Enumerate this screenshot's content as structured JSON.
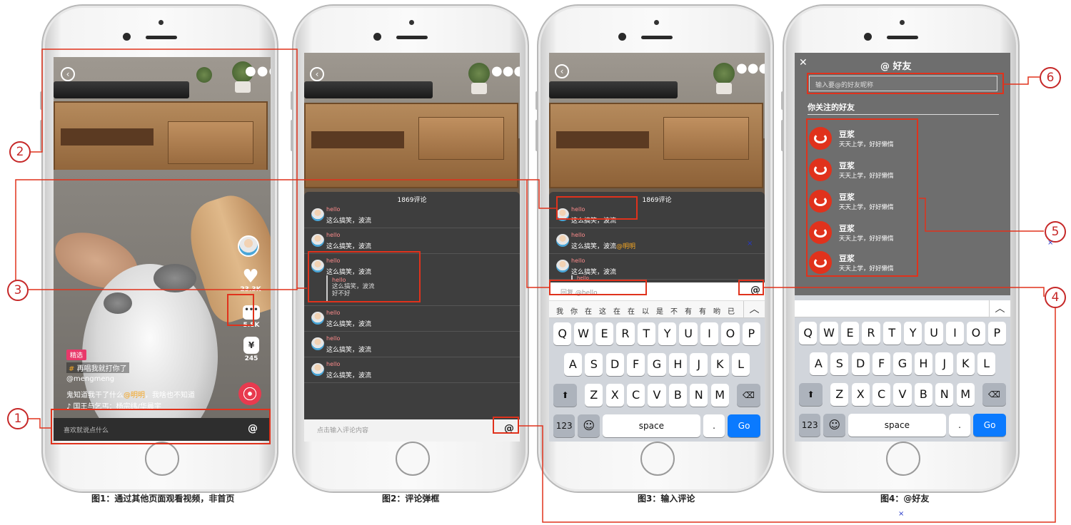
{
  "phone1": {
    "tag": "精选",
    "hashtag_symbol": "#",
    "hashtag": "再唱我就打你了",
    "username": "@mengmeng",
    "caption_pre": "鬼知道我干了什么",
    "caption_mention": "@明明",
    "caption_post": "，我啥也不知道",
    "music": "♪ 国王与乞丐：杨宗纬/华晨宇",
    "likes": "23.3K",
    "comments": "5.8K",
    "coins": "245",
    "coin_symbol": "¥",
    "input_placeholder": "喜欢就说点什么",
    "at_symbol": "@",
    "caption_label": "图1：通过其他页面观看视频，非首页"
  },
  "phone2": {
    "count": "1869评论",
    "comments": [
      {
        "name": "hello",
        "text": "这么搞笑，波流"
      },
      {
        "name": "hello",
        "text": "这么搞笑，波流"
      },
      {
        "name": "hello",
        "text": "这么搞笑，波流",
        "reply_name": "hello",
        "reply_text": "这么搞笑，波流",
        "reply_text2": "好不好"
      },
      {
        "name": "hello",
        "text": "这么搞笑，波流"
      },
      {
        "name": "hello",
        "text": "这么搞笑，波流"
      },
      {
        "name": "hello",
        "text": "这么搞笑，波流"
      }
    ],
    "input_placeholder": "点击输入评论内容",
    "at_symbol": "@",
    "caption_label": "图2：评论弹框"
  },
  "phone3": {
    "count": "1869评论",
    "c1_name": "hello",
    "c1_text": "这么搞笑，波流",
    "c2_name": "hello",
    "c2_text": "这么搞笑，波流",
    "c2_mention": "@明明",
    "c3_name": "hello",
    "c3_text": "这么搞笑，波流",
    "c4_name": "hello",
    "reply_placeholder": "回复 @hello",
    "at_symbol": "@",
    "candidates": [
      "我",
      "你",
      "在",
      "这",
      "在",
      "在",
      "以",
      "是",
      "不",
      "有",
      "有",
      "哟",
      "已"
    ],
    "caption_label": "图3：输入评论"
  },
  "phone4": {
    "close": "✕",
    "title": "@ 好友",
    "search_placeholder": "输入要@的好友昵称",
    "section": "你关注的好友",
    "friends": [
      {
        "name": "豆浆",
        "sub": "天天上学，好好懒惰"
      },
      {
        "name": "豆浆",
        "sub": "天天上学，好好懒惰"
      },
      {
        "name": "豆浆",
        "sub": "天天上学，好好懒惰"
      },
      {
        "name": "豆浆",
        "sub": "天天上学，好好懒惰"
      },
      {
        "name": "豆浆",
        "sub": "天天上学，好好懒惰"
      }
    ],
    "caption_label": "图4：@好友"
  },
  "keyboard": {
    "row1": [
      "Q",
      "W",
      "E",
      "R",
      "T",
      "Y",
      "U",
      "I",
      "O",
      "P"
    ],
    "row2": [
      "A",
      "S",
      "D",
      "F",
      "G",
      "H",
      "J",
      "K",
      "L"
    ],
    "row3": [
      "Z",
      "X",
      "C",
      "V",
      "B",
      "N",
      "M"
    ],
    "num": "123",
    "emoji": "☺",
    "space": "space",
    "dot": ".",
    "go": "Go",
    "shift": "⬆",
    "backspace": "⌫",
    "collapse": "︿"
  },
  "markers": [
    "1",
    "2",
    "3",
    "4",
    "5",
    "6"
  ],
  "blue_x": "×",
  "colors": {
    "accent_red": "#e0321c",
    "link_blue": "#0a7aff",
    "mention": "#f5a623",
    "tag_pink": "#e8396a"
  }
}
